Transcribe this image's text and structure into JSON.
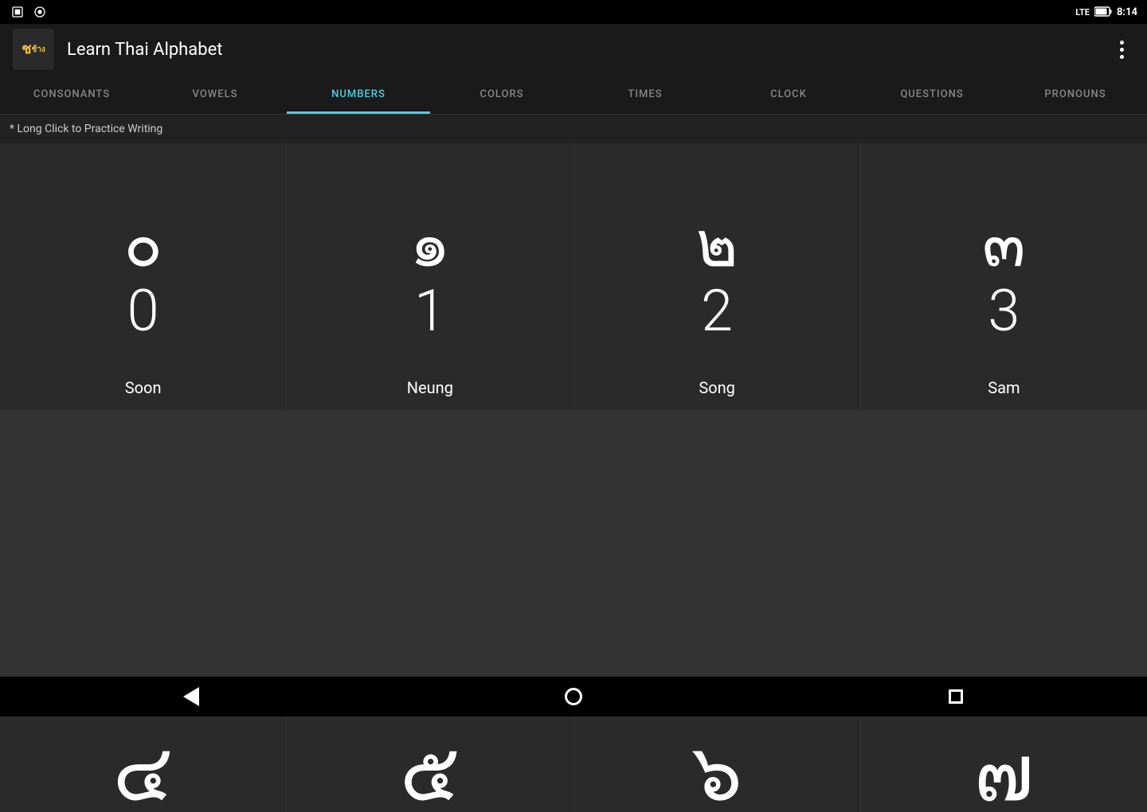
{
  "statusBar": {
    "time": "8:14",
    "icons": [
      "battery",
      "signal"
    ]
  },
  "appBar": {
    "title": "Learn Thai Alphabet",
    "logo_line1": "ช",
    "logo_line2": "ช้าง",
    "more_menu_label": "More options"
  },
  "tabs": [
    {
      "id": "consonants",
      "label": "CONSONANTS",
      "active": false
    },
    {
      "id": "vowels",
      "label": "VOWELS",
      "active": false
    },
    {
      "id": "numbers",
      "label": "NUMBERS",
      "active": true
    },
    {
      "id": "colors",
      "label": "COLORS",
      "active": false
    },
    {
      "id": "times",
      "label": "TIMES",
      "active": false
    },
    {
      "id": "clock",
      "label": "CLOCK",
      "active": false
    },
    {
      "id": "questions",
      "label": "QUESTIONS",
      "active": false
    },
    {
      "id": "pronouns",
      "label": "PRONOUNS",
      "active": false
    }
  ],
  "subtitle": "* Long Click to Practice Writing",
  "cards": [
    {
      "thai": "๐",
      "number": "0",
      "label": "Soon"
    },
    {
      "thai": "๑",
      "number": "1",
      "label": "Neung"
    },
    {
      "thai": "๒",
      "number": "2",
      "label": "Song"
    },
    {
      "thai": "๓",
      "number": "3",
      "label": "Sam"
    }
  ],
  "partialCards": [
    {
      "thai": "๔"
    },
    {
      "thai": "๕"
    },
    {
      "thai": "๖"
    },
    {
      "thai": "๗"
    }
  ],
  "nav": {
    "back": "back",
    "home": "home",
    "recent": "recent"
  }
}
